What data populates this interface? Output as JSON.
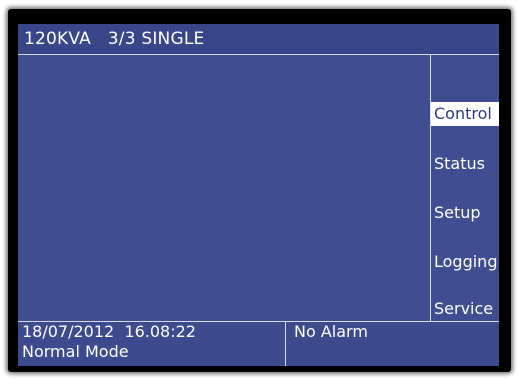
{
  "header": {
    "title": "120KVA   3/3 SINGLE"
  },
  "menu": {
    "items": [
      {
        "label": "Control",
        "selected": true
      },
      {
        "label": "Status",
        "selected": false
      },
      {
        "label": "Setup",
        "selected": false
      },
      {
        "label": "Logging",
        "selected": false
      },
      {
        "label": "Service",
        "selected": false
      }
    ]
  },
  "status": {
    "datetime": "18/07/2012  16.08:22",
    "mode": "Normal Mode",
    "alarm": "No Alarm"
  },
  "colors": {
    "screen_background": "#3f4e90",
    "text": "#ffffff",
    "selected_background": "#ffffff",
    "selected_text": "#2e3c7c",
    "bezel": "#000000"
  }
}
